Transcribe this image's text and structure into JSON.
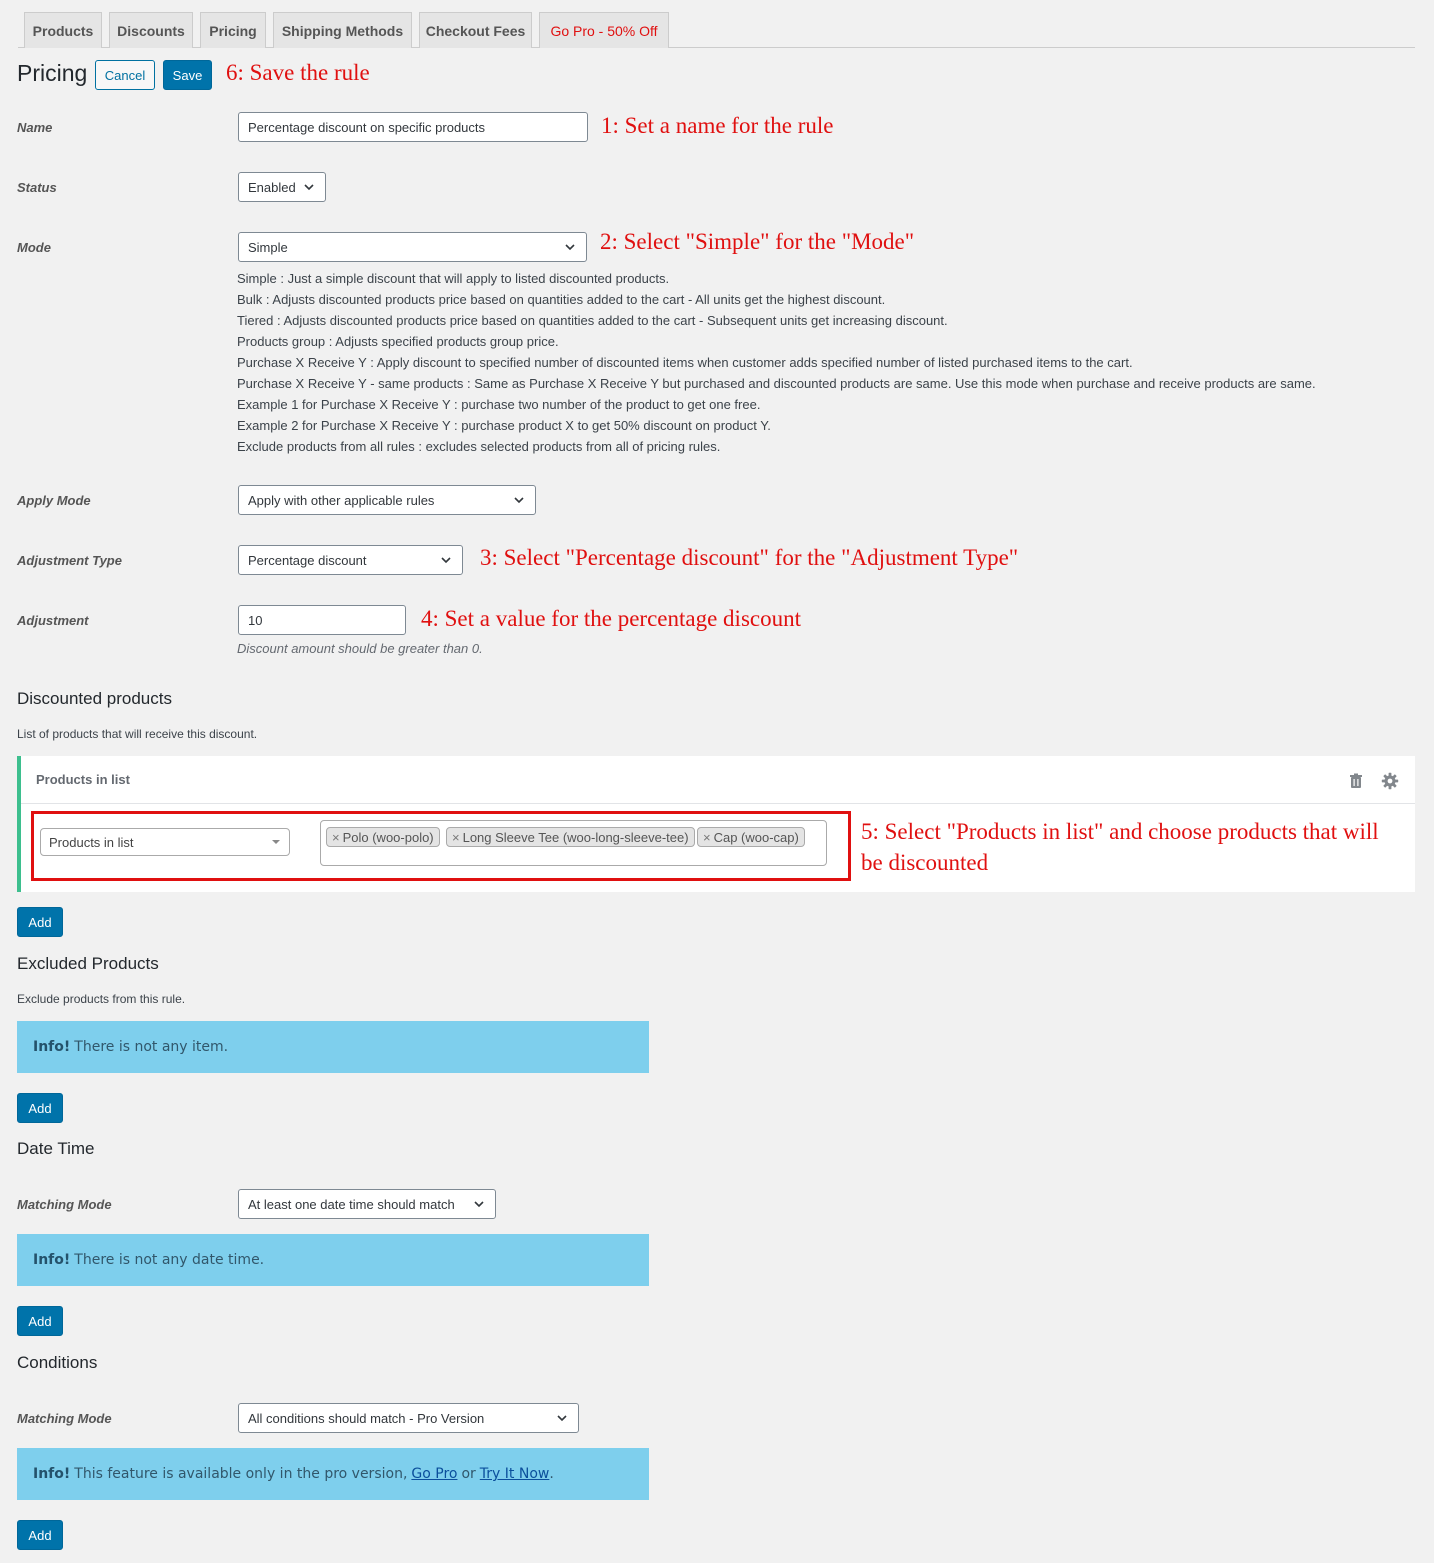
{
  "tabs": [
    {
      "label": "Products"
    },
    {
      "label": "Discounts"
    },
    {
      "label": "Pricing"
    },
    {
      "label": "Shipping Methods"
    },
    {
      "label": "Checkout Fees"
    },
    {
      "label": "Go Pro - 50% Off"
    }
  ],
  "header": {
    "title": "Pricing",
    "cancel_label": "Cancel",
    "save_label": "Save"
  },
  "annotations": {
    "a1": "1: Set a name for the rule",
    "a2": "2: Select \"Simple\" for the \"Mode\"",
    "a3": "3: Select \"Percentage discount\" for the \"Adjustment Type\"",
    "a4": "4: Set a value for the percentage discount",
    "a5_line1": "5: Select \"Products in list\" and choose products that will",
    "a5_line2": "be discounted",
    "a6": "6: Save the rule"
  },
  "form": {
    "name_label": "Name",
    "name_value": "Percentage discount on specific products",
    "status_label": "Status",
    "status_value": "Enabled",
    "mode_label": "Mode",
    "mode_value": "Simple",
    "mode_help": [
      "Simple : Just a simple discount that will apply to listed discounted products.",
      "Bulk : Adjusts discounted products price based on quantities added to the cart - All units get the highest discount.",
      "Tiered : Adjusts discounted products price based on quantities added to the cart - Subsequent units get increasing discount.",
      "Products group : Adjusts specified products group price.",
      "Purchase X Receive Y : Apply discount to specified number of discounted items when customer adds specified number of listed purchased items to the cart.",
      "Purchase X Receive Y - same products : Same as Purchase X Receive Y but purchased and discounted products are same. Use this mode when purchase and receive products are same.",
      "Example 1 for Purchase X Receive Y : purchase two number of the product to get one free.",
      "Example 2 for Purchase X Receive Y : purchase product X to get 50% discount on product Y.",
      "Exclude products from all rules : excludes selected products from all of pricing rules."
    ],
    "apply_mode_label": "Apply Mode",
    "apply_mode_value": "Apply with other applicable rules",
    "adjustment_type_label": "Adjustment Type",
    "adjustment_type_value": "Percentage discount",
    "adjustment_label": "Adjustment",
    "adjustment_value": "10",
    "adjustment_desc": "Discount amount should be greater than 0."
  },
  "discounted": {
    "title": "Discounted products",
    "desc": "List of products that will receive this discount.",
    "panel_title": "Products in list",
    "select_value": "Products in list",
    "chips": [
      "Polo (woo-polo)",
      "Long Sleeve Tee (woo-long-sleeve-tee)",
      "Cap (woo-cap)"
    ],
    "add_label": "Add"
  },
  "excluded": {
    "title": "Excluded Products",
    "desc": "Exclude products from this rule.",
    "info_strong": "Info!",
    "info_text": "There is not any item.",
    "add_label": "Add"
  },
  "datetime": {
    "title": "Date Time",
    "matching_label": "Matching Mode",
    "matching_value": "At least one date time should match",
    "info_strong": "Info!",
    "info_text": "There is not any date time.",
    "add_label": "Add"
  },
  "conditions": {
    "title": "Conditions",
    "matching_label": "Matching Mode",
    "matching_value": "All conditions should match - Pro Version",
    "info_strong": "Info!",
    "info_text": "This feature is available only in the pro version,",
    "link_go_pro": "Go Pro",
    "or_text": "or",
    "link_try": "Try It Now",
    "period": ".",
    "add_label": "Add"
  },
  "colors": {
    "accent": "#0073aa",
    "annotation": "#e01010",
    "info_bg": "#7ecfed",
    "panel_border": "#3dbf8e"
  }
}
